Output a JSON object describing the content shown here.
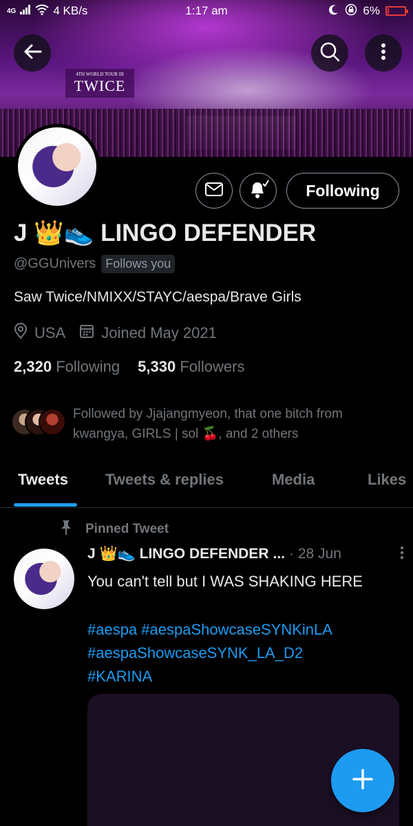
{
  "status_bar": {
    "network": "4G",
    "speed": "4 KB/s",
    "time": "1:17 am",
    "battery": "6%",
    "battery_level": 0.06
  },
  "banner": {
    "screen_text": "TWICE",
    "screen_subtext": "4TH WORLD TOUR III"
  },
  "icons": {
    "back": "arrow-left",
    "search": "magnifier",
    "more": "vertical-dots",
    "mail": "envelope",
    "bell": "bell-with-check",
    "location": "map-pin",
    "calendar": "calendar",
    "pin": "pushpin",
    "compose": "plus"
  },
  "profile": {
    "follow_button": "Following",
    "display_name": "J 👑👟 LINGO DEFENDER",
    "handle": "@GGUnivers",
    "follows_you": "Follows you",
    "bio": "Saw Twice/NMIXX/STAYC/aespa/Brave Girls",
    "location": "USA",
    "joined": "Joined May 2021",
    "following_count": "2,320",
    "following_label": "Following",
    "followers_count": "5,330",
    "followers_label": "Followers",
    "followed_by": "Followed by Jjajangmyeon, that one bitch from kwangya, GIRLS | sol 🍒, and 2 others"
  },
  "tabs": [
    "Tweets",
    "Tweets & replies",
    "Media",
    "Likes"
  ],
  "active_tab": "Tweets",
  "pinned_tweet": {
    "pinned_label": "Pinned Tweet",
    "author_name": "J 👑👟 LINGO DEFENDER",
    "ellipsis": "...",
    "date": "· 28 Jun",
    "text": "You can't tell but I WAS SHAKING HERE",
    "hashtags": [
      "#aespa #aespaShowcaseSYNKinLA",
      "#aespaShowcaseSYNK_LA_D2",
      "#KARINA"
    ]
  },
  "colors": {
    "accent": "#1d9bf0",
    "background": "#000000",
    "text_primary": "#e7e9ea",
    "text_secondary": "#71767b",
    "battery_low": "#e53935"
  }
}
